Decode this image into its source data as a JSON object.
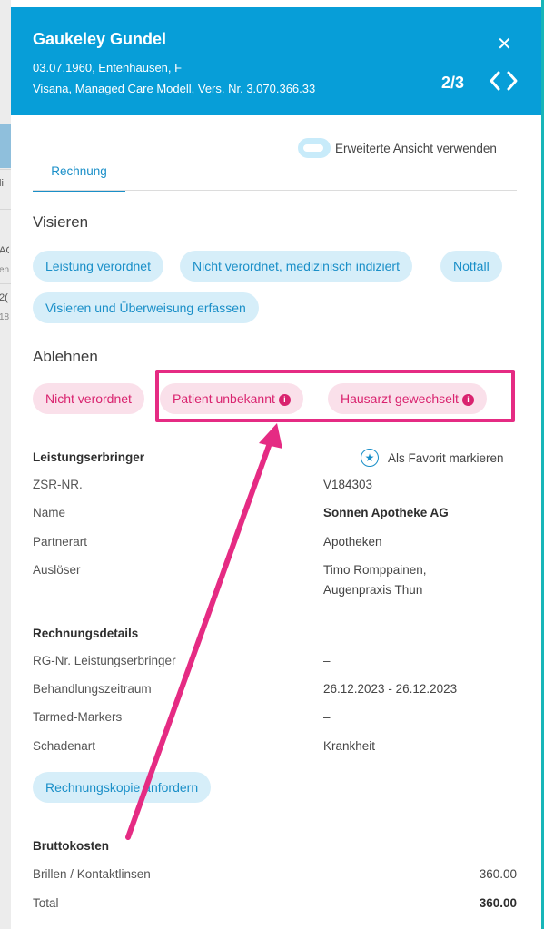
{
  "background": {
    "snippets": [
      "li",
      "AG",
      "en",
      "2(",
      "18"
    ]
  },
  "header": {
    "patient_name": "Gaukeley Gundel",
    "patient_details": "03.07.1960, Entenhausen, F",
    "insurance_details": "Visana, Managed Care Modell, Vers. Nr. 3.070.366.33",
    "pager": "2/3",
    "close_icon": "close-icon",
    "nav_icons": [
      "chevron-left-icon",
      "chevron-right-icon"
    ]
  },
  "view_toggle": {
    "label": "Erweiterte Ansicht verwenden",
    "on": false
  },
  "tabs": [
    {
      "label": "Rechnung",
      "active": true
    }
  ],
  "visieren": {
    "title": "Visieren",
    "actions": [
      "Leistung verordnet",
      "Nicht verordnet, medizinisch indiziert",
      "Notfall",
      "Visieren und Überweisung erfassen"
    ]
  },
  "ablehnen": {
    "title": "Ablehnen",
    "actions": [
      {
        "label": "Nicht verordnet",
        "info": false
      },
      {
        "label": "Patient unbekannt",
        "info": true
      },
      {
        "label": "Hausarzt gewechselt",
        "info": true
      }
    ]
  },
  "leistungserbringer": {
    "title": "Leistungserbringer",
    "favorite_label": "Als Favorit markieren",
    "rows": [
      {
        "label": "ZSR-NR.",
        "value": "V184303"
      },
      {
        "label": "Name",
        "value": "Sonnen Apotheke AG"
      },
      {
        "label": "Partnerart",
        "value": "Apotheken"
      },
      {
        "label": "Auslöser",
        "value": "Timo Romppainen,",
        "value2": "Augenpraxis Thun"
      }
    ]
  },
  "rechnungsdetails": {
    "title": "Rechnungsdetails",
    "rows": [
      {
        "label": "RG-Nr. Leistungserbringer",
        "value": "–"
      },
      {
        "label": "Behandlungszeitraum",
        "value": "26.12.2023 - 26.12.2023"
      },
      {
        "label": "Tarmed-Markers",
        "value": "–"
      },
      {
        "label": "Schadenart",
        "value": "Krankheit"
      }
    ],
    "copy_button": "Rechnungskopie anfordern"
  },
  "bruttokosten": {
    "title": "Bruttokosten",
    "rows": [
      {
        "label": "Brillen / Kontaktlinsen",
        "value": "360.00"
      },
      {
        "label": "Total",
        "value": "360.00"
      }
    ]
  },
  "annotation": {
    "color": "#e52b83"
  }
}
